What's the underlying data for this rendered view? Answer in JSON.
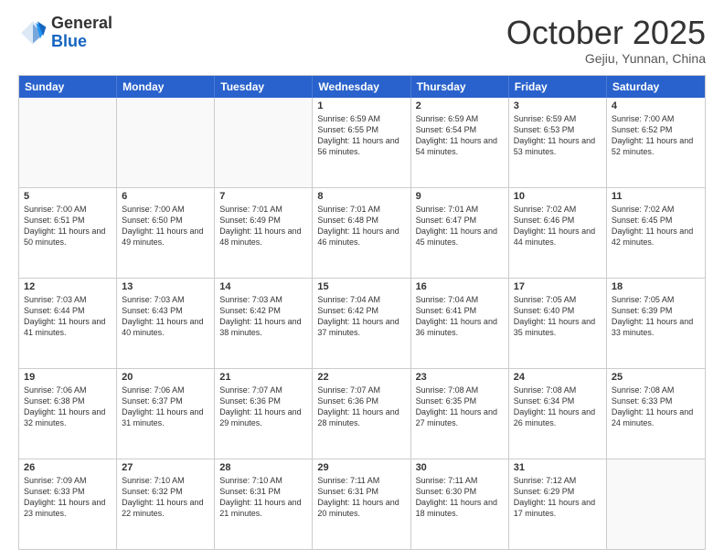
{
  "header": {
    "logo": {
      "general": "General",
      "blue": "Blue"
    },
    "month": "October 2025",
    "location": "Gejiu, Yunnan, China"
  },
  "days": [
    "Sunday",
    "Monday",
    "Tuesday",
    "Wednesday",
    "Thursday",
    "Friday",
    "Saturday"
  ],
  "weeks": [
    [
      {
        "day": "",
        "empty": true
      },
      {
        "day": "",
        "empty": true
      },
      {
        "day": "",
        "empty": true
      },
      {
        "day": "1",
        "sunrise": "6:59 AM",
        "sunset": "6:55 PM",
        "daylight": "11 hours and 56 minutes."
      },
      {
        "day": "2",
        "sunrise": "6:59 AM",
        "sunset": "6:54 PM",
        "daylight": "11 hours and 54 minutes."
      },
      {
        "day": "3",
        "sunrise": "6:59 AM",
        "sunset": "6:53 PM",
        "daylight": "11 hours and 53 minutes."
      },
      {
        "day": "4",
        "sunrise": "7:00 AM",
        "sunset": "6:52 PM",
        "daylight": "11 hours and 52 minutes."
      }
    ],
    [
      {
        "day": "5",
        "sunrise": "7:00 AM",
        "sunset": "6:51 PM",
        "daylight": "11 hours and 50 minutes."
      },
      {
        "day": "6",
        "sunrise": "7:00 AM",
        "sunset": "6:50 PM",
        "daylight": "11 hours and 49 minutes."
      },
      {
        "day": "7",
        "sunrise": "7:01 AM",
        "sunset": "6:49 PM",
        "daylight": "11 hours and 48 minutes."
      },
      {
        "day": "8",
        "sunrise": "7:01 AM",
        "sunset": "6:48 PM",
        "daylight": "11 hours and 46 minutes."
      },
      {
        "day": "9",
        "sunrise": "7:01 AM",
        "sunset": "6:47 PM",
        "daylight": "11 hours and 45 minutes."
      },
      {
        "day": "10",
        "sunrise": "7:02 AM",
        "sunset": "6:46 PM",
        "daylight": "11 hours and 44 minutes."
      },
      {
        "day": "11",
        "sunrise": "7:02 AM",
        "sunset": "6:45 PM",
        "daylight": "11 hours and 42 minutes."
      }
    ],
    [
      {
        "day": "12",
        "sunrise": "7:03 AM",
        "sunset": "6:44 PM",
        "daylight": "11 hours and 41 minutes."
      },
      {
        "day": "13",
        "sunrise": "7:03 AM",
        "sunset": "6:43 PM",
        "daylight": "11 hours and 40 minutes."
      },
      {
        "day": "14",
        "sunrise": "7:03 AM",
        "sunset": "6:42 PM",
        "daylight": "11 hours and 38 minutes."
      },
      {
        "day": "15",
        "sunrise": "7:04 AM",
        "sunset": "6:42 PM",
        "daylight": "11 hours and 37 minutes."
      },
      {
        "day": "16",
        "sunrise": "7:04 AM",
        "sunset": "6:41 PM",
        "daylight": "11 hours and 36 minutes."
      },
      {
        "day": "17",
        "sunrise": "7:05 AM",
        "sunset": "6:40 PM",
        "daylight": "11 hours and 35 minutes."
      },
      {
        "day": "18",
        "sunrise": "7:05 AM",
        "sunset": "6:39 PM",
        "daylight": "11 hours and 33 minutes."
      }
    ],
    [
      {
        "day": "19",
        "sunrise": "7:06 AM",
        "sunset": "6:38 PM",
        "daylight": "11 hours and 32 minutes."
      },
      {
        "day": "20",
        "sunrise": "7:06 AM",
        "sunset": "6:37 PM",
        "daylight": "11 hours and 31 minutes."
      },
      {
        "day": "21",
        "sunrise": "7:07 AM",
        "sunset": "6:36 PM",
        "daylight": "11 hours and 29 minutes."
      },
      {
        "day": "22",
        "sunrise": "7:07 AM",
        "sunset": "6:36 PM",
        "daylight": "11 hours and 28 minutes."
      },
      {
        "day": "23",
        "sunrise": "7:08 AM",
        "sunset": "6:35 PM",
        "daylight": "11 hours and 27 minutes."
      },
      {
        "day": "24",
        "sunrise": "7:08 AM",
        "sunset": "6:34 PM",
        "daylight": "11 hours and 26 minutes."
      },
      {
        "day": "25",
        "sunrise": "7:08 AM",
        "sunset": "6:33 PM",
        "daylight": "11 hours and 24 minutes."
      }
    ],
    [
      {
        "day": "26",
        "sunrise": "7:09 AM",
        "sunset": "6:33 PM",
        "daylight": "11 hours and 23 minutes."
      },
      {
        "day": "27",
        "sunrise": "7:10 AM",
        "sunset": "6:32 PM",
        "daylight": "11 hours and 22 minutes."
      },
      {
        "day": "28",
        "sunrise": "7:10 AM",
        "sunset": "6:31 PM",
        "daylight": "11 hours and 21 minutes."
      },
      {
        "day": "29",
        "sunrise": "7:11 AM",
        "sunset": "6:31 PM",
        "daylight": "11 hours and 20 minutes."
      },
      {
        "day": "30",
        "sunrise": "7:11 AM",
        "sunset": "6:30 PM",
        "daylight": "11 hours and 18 minutes."
      },
      {
        "day": "31",
        "sunrise": "7:12 AM",
        "sunset": "6:29 PM",
        "daylight": "11 hours and 17 minutes."
      },
      {
        "day": "",
        "empty": true
      }
    ]
  ]
}
